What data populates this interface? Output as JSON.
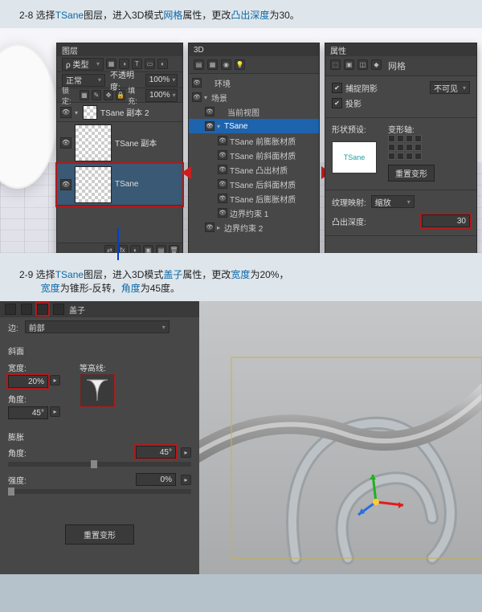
{
  "steps": {
    "s28": {
      "prefix": "2-8 选择",
      "layer": "TSane",
      "mid1": "图层，进入3D模式",
      "prop": "网格",
      "mid2": "属性，更改",
      "field": "凸出深度",
      "mid3": "为30。"
    },
    "s29": {
      "prefix": "2-9 选择",
      "layer": "TSane",
      "mid1": "图层，进入3D模式",
      "prop": "盖子",
      "mid2": "属性，更改",
      "field1": "宽度",
      "mid3": "为20%，",
      "line2a": "",
      "field2": "宽度",
      "txt2": "为锥形-反转，",
      "field3": "角度",
      "txt3": "为45度。"
    }
  },
  "layers": {
    "tab": "图层",
    "filter_label": "ρ 类型",
    "blend_mode": "正常",
    "opacity_label": "不透明度:",
    "opacity": "100%",
    "lock_label": "锁定:",
    "fill_label": "填充:",
    "fill": "100%",
    "items": {
      "l0": "TSane 副本 2",
      "l1": "TSane 副本",
      "l2": "TSane"
    }
  },
  "p3d": {
    "tab": "3D",
    "items": {
      "env": "环境",
      "scene": "场景",
      "view": "当前视图",
      "tsane": "TSane",
      "mat1": "TSane 前膨胀材质",
      "mat2": "TSane 前斜面材质",
      "mat3": "TSane 凸出材质",
      "mat4": "TSane 后斜面材质",
      "mat5": "TSane 后膨胀材质",
      "cons1": "边界约束 1",
      "cons2": "边界约束 2"
    }
  },
  "props": {
    "tab": "属性",
    "mesh": "网格",
    "catch_shadow": "捕捉阴影",
    "invisible": "不可见",
    "cast_shadow": "投影",
    "shape_preset": "形状预设:",
    "deform_axis": "变形轴:",
    "thumb": "TSane",
    "reset": "重置变形",
    "tex_map": "纹理映射:",
    "tex_val": "缩放",
    "extrude_label": "凸出深度:",
    "extrude_val": "30"
  },
  "cap": {
    "title": "盖子",
    "side_label": "边:",
    "side_val": "前部",
    "bevel": "斜面",
    "contour": "等高线:",
    "width_label": "宽度:",
    "width": "20%",
    "angle_label": "角度:",
    "angle1": "45°",
    "inflate": "膨胀",
    "angle2": "45°",
    "intensity_label": "强度:",
    "intensity": "0%",
    "reset": "重置变形"
  }
}
